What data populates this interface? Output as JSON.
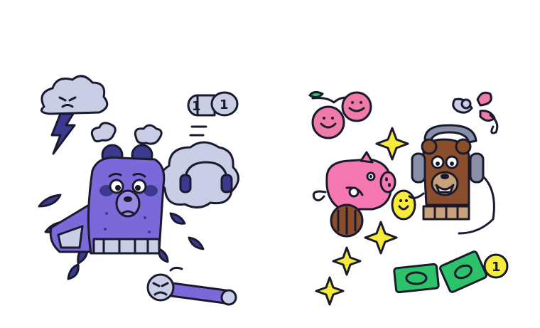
{
  "illustration": {
    "left_scene": {
      "coin_labels": [
        "1",
        "1"
      ]
    },
    "right_scene": {
      "coin_label": "1"
    }
  },
  "colors": {
    "purple": "#7b68d9",
    "purple_dark": "#3b3a8f",
    "cloud": "#c9cde6",
    "pink": "#f07aa8",
    "pig": "#f579b0",
    "brown": "#8a4e2c",
    "tan": "#c9a27a",
    "yellow": "#f6ea3a",
    "green": "#2bc26a",
    "gray": "#8a8fa8",
    "outline": "#1a1a2e"
  }
}
